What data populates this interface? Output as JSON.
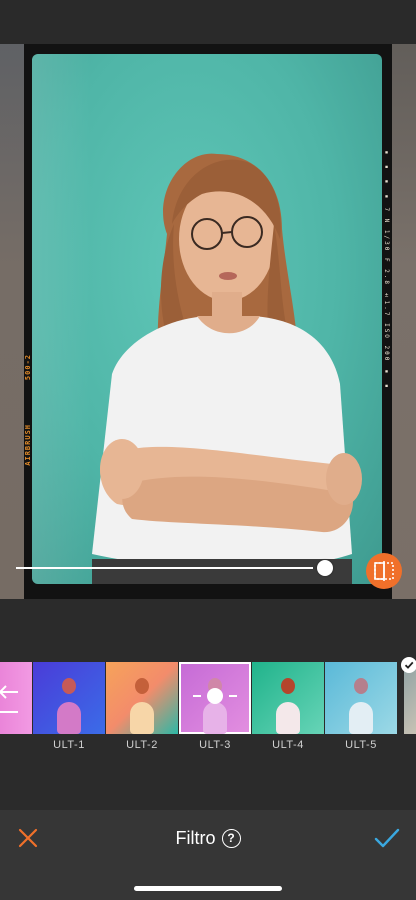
{
  "editor": {
    "film_left_text": "AIRBRUSH",
    "film_left_code": "500-2",
    "film_right_text": "▪ ▪ ▪ ▪ 7 N 1/30 F 2.8 ±1.7 ISO 200 ▪ ▪ ▪ ▪",
    "intensity": 0.95
  },
  "filters": [
    {
      "label": "",
      "icon": "undo-icon"
    },
    {
      "label": "ULT-1"
    },
    {
      "label": "ULT-2"
    },
    {
      "label": "ULT-3",
      "selected": true
    },
    {
      "label": "ULT-4"
    },
    {
      "label": "ULT-5"
    }
  ],
  "bottom_bar": {
    "title": "Filtro",
    "help_label": "?",
    "cancel_icon": "close-icon",
    "confirm_icon": "check-icon"
  },
  "colors": {
    "accent": "#f0702a",
    "confirm": "#3aa8e0",
    "background": "#2b2b2b",
    "bar": "#363636"
  }
}
